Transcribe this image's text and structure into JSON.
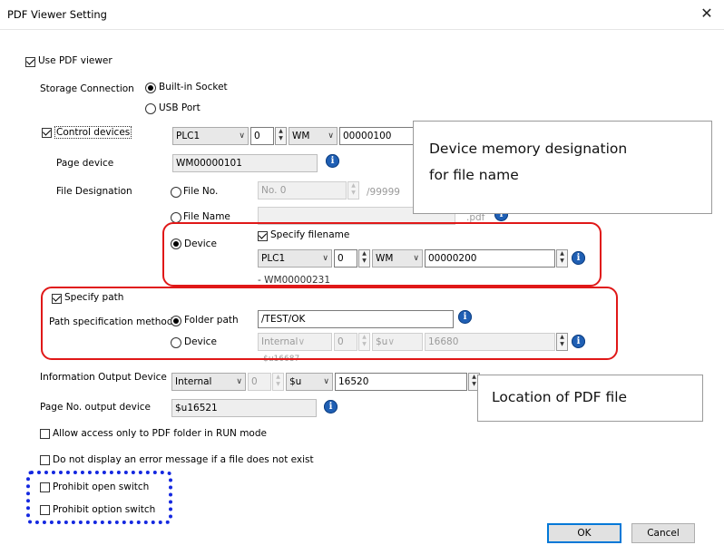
{
  "dialog": {
    "title": "PDF Viewer Setting",
    "close_glyph": "✕"
  },
  "use_pdf_viewer": {
    "label": "Use PDF viewer",
    "checked": true
  },
  "storage": {
    "label": "Storage Connection",
    "option1": "Built-in Socket",
    "option2": "USB Port"
  },
  "control_devices": {
    "label": "Control devices",
    "checked": true,
    "plc": "PLC1",
    "station": "0",
    "type": "WM",
    "address": "00000100"
  },
  "page_device": {
    "label": "Page device",
    "value": "WM00000101"
  },
  "file_designation": {
    "label": "File Designation",
    "file_no_label": "File No.",
    "no_prefix": "No.",
    "no_value": "0",
    "no_max": "/99999",
    "file_name_label": "File Name",
    "pdf_ext": ".pdf",
    "device_label": "Device",
    "specify_filename_label": "Specify filename",
    "plc": "PLC1",
    "station": "0",
    "type": "WM",
    "address": "00000200",
    "range_text": "- WM00000231"
  },
  "specify_path": {
    "label": "Specify path",
    "checked": true,
    "method_label": "Path specification method",
    "folder_path_label": "Folder path",
    "folder_path_value": "/TEST/OK",
    "device_label": "Device",
    "dev_plc": "Internal",
    "dev_station": "0",
    "dev_type": "$u",
    "dev_address": "16680",
    "dev_range": "- $u16687"
  },
  "info_output": {
    "label": "Information Output Device",
    "plc": "Internal",
    "station": "0",
    "type": "$u",
    "address": "16520"
  },
  "page_no_output": {
    "label": "Page No. output device",
    "value": "$u16521"
  },
  "options": {
    "allow_access": "Allow access only to PDF folder in RUN mode",
    "no_error_msg": "Do not display an error message if a file does not exist",
    "prohibit_open": "Prohibit open switch",
    "prohibit_option": "Prohibit option switch"
  },
  "buttons": {
    "ok": "OK",
    "cancel": "Cancel"
  },
  "callouts": {
    "device_memory_line1": "Device memory designation",
    "device_memory_line2": "for file name",
    "location": "Location of PDF file"
  },
  "colors": {
    "highlight_red": "#e01818",
    "highlight_blue": "#1428e0",
    "info_icon": "#1f5fb4"
  }
}
